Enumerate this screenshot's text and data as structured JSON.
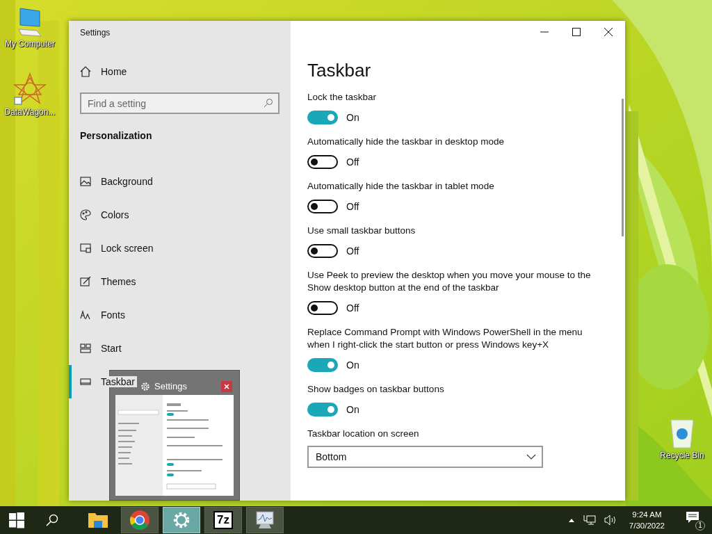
{
  "desktop_icons": [
    {
      "label": "My Computer"
    },
    {
      "label": "DataWagon..."
    },
    {
      "label": "Recycle Bin"
    }
  ],
  "window": {
    "title": "Settings",
    "home": "Home",
    "search": {
      "placeholder": "Find a setting"
    },
    "section": "Personalization",
    "nav_items": [
      {
        "label": "Background",
        "selected": false
      },
      {
        "label": "Colors",
        "selected": false
      },
      {
        "label": "Lock screen",
        "selected": false
      },
      {
        "label": "Themes",
        "selected": false
      },
      {
        "label": "Fonts",
        "selected": false
      },
      {
        "label": "Start",
        "selected": false
      },
      {
        "label": "Taskbar",
        "selected": true
      }
    ],
    "page_title": "Taskbar",
    "settings": [
      {
        "kind": "toggle",
        "label": "Lock the taskbar",
        "on": true,
        "state_text": "On"
      },
      {
        "kind": "toggle",
        "label": "Automatically hide the taskbar in desktop mode",
        "on": false,
        "state_text": "Off"
      },
      {
        "kind": "toggle",
        "label": "Automatically hide the taskbar in tablet mode",
        "on": false,
        "state_text": "Off"
      },
      {
        "kind": "toggle",
        "label": "Use small taskbar buttons",
        "on": false,
        "state_text": "Off"
      },
      {
        "kind": "toggle",
        "label": "Use Peek to preview the desktop when you move your mouse to the Show desktop button at the end of the taskbar",
        "on": false,
        "state_text": "Off"
      },
      {
        "kind": "toggle",
        "label": "Replace Command Prompt with Windows PowerShell in the menu when I right-click the start button or press Windows key+X",
        "on": true,
        "state_text": "On"
      },
      {
        "kind": "toggle",
        "label": "Show badges on taskbar buttons",
        "on": true,
        "state_text": "On"
      },
      {
        "kind": "dropdown",
        "label": "Taskbar location on screen",
        "value": "Bottom"
      }
    ]
  },
  "thumbnail": {
    "title": "Settings"
  },
  "taskbar": {
    "apps": [
      {
        "kind": "explorer",
        "running": false,
        "selected": false
      },
      {
        "kind": "chrome",
        "running": true,
        "selected": false
      },
      {
        "kind": "settings",
        "running": true,
        "selected": true
      },
      {
        "kind": "sevenzip",
        "label": "7z",
        "running": true,
        "selected": false
      },
      {
        "kind": "monitor",
        "running": true,
        "selected": false
      }
    ],
    "clock": {
      "time": "9:24 AM",
      "date": "7/30/2022"
    },
    "notification_count": "1"
  }
}
